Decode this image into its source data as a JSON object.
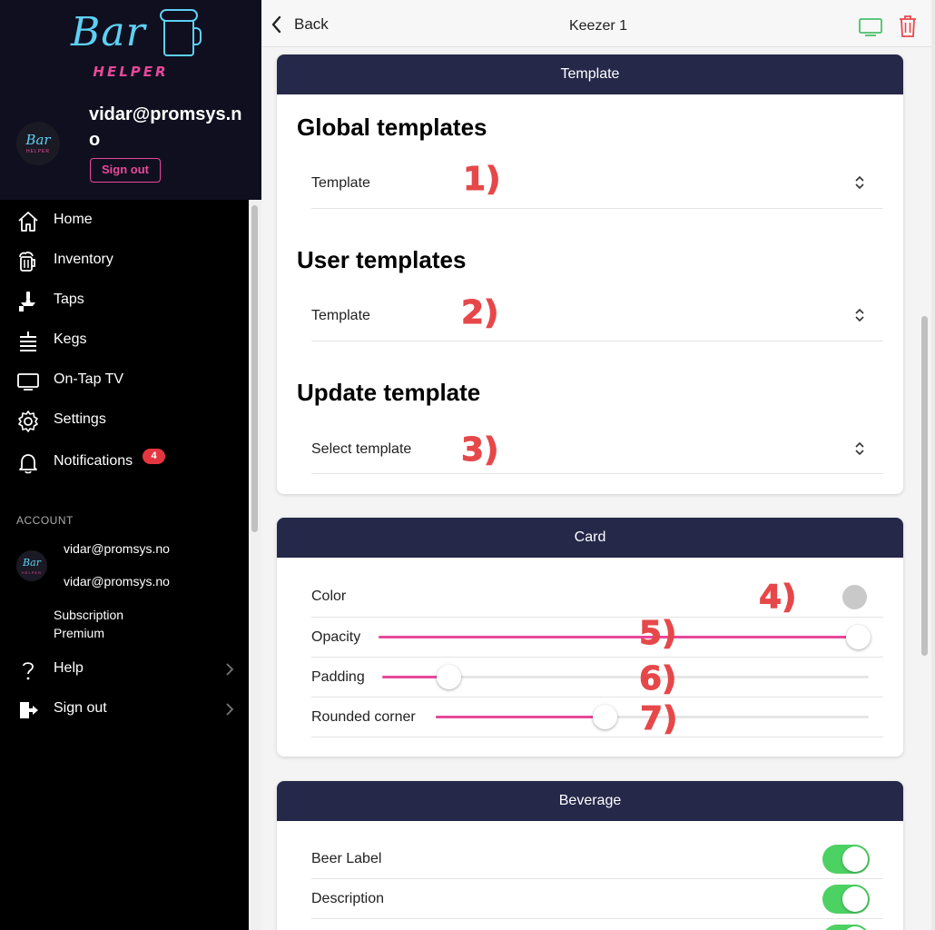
{
  "app": {
    "logo_main": "Bar",
    "logo_sub": "HELPER",
    "avatar_logo_main": "Bar",
    "avatar_logo_sub": "HELPER"
  },
  "sidebar": {
    "profile_email": "vidar@promsys.no",
    "signout_button": "Sign out",
    "nav": [
      {
        "label": "Home",
        "icon": "home-icon"
      },
      {
        "label": "Inventory",
        "icon": "beer-mug-icon"
      },
      {
        "label": "Taps",
        "icon": "tap-icon"
      },
      {
        "label": "Kegs",
        "icon": "keg-icon"
      },
      {
        "label": "On-Tap TV",
        "icon": "tv-icon"
      },
      {
        "label": "Settings",
        "icon": "gear-icon"
      },
      {
        "label": "Notifications",
        "icon": "bell-icon",
        "badge": "4"
      }
    ],
    "account": {
      "header": "ACCOUNT",
      "line1": "vidar@promsys.no",
      "line2": "vidar@promsys.no",
      "subscription_label": "Subscription",
      "subscription_plan": "Premium"
    },
    "bottom_nav": [
      {
        "label": "Help",
        "icon": "question-icon"
      },
      {
        "label": "Sign out",
        "icon": "sign-out-icon"
      }
    ]
  },
  "topbar": {
    "back_label": "Back",
    "title": "Keezer 1",
    "tv_icon": "tv-icon",
    "trash_icon": "trash-icon"
  },
  "template_card": {
    "header": "Template",
    "global_title": "Global templates",
    "global_select": "Template",
    "user_title": "User templates",
    "user_select": "Template",
    "update_title": "Update template",
    "update_select": "Select template"
  },
  "card_card": {
    "header": "Card",
    "color_label": "Color",
    "opacity_label": "Opacity",
    "opacity_value": 1.0,
    "padding_label": "Padding",
    "padding_value": 0.14,
    "rounded_label": "Rounded corner",
    "rounded_value": 0.4
  },
  "beverage_card": {
    "header": "Beverage",
    "rows": [
      {
        "label": "Beer Label",
        "on": true
      },
      {
        "label": "Description",
        "on": true
      }
    ]
  },
  "annotations": [
    "1)",
    "2)",
    "3)",
    "4)",
    "5)",
    "6)",
    "7)"
  ],
  "colors": {
    "header_navy": "#252849",
    "accent_pink": "#e8489a",
    "toggle_green": "#4cd263",
    "annotation_red": "#e6484a",
    "logo_cyan": "#5ed0f4",
    "badge_red": "#e5363f"
  }
}
